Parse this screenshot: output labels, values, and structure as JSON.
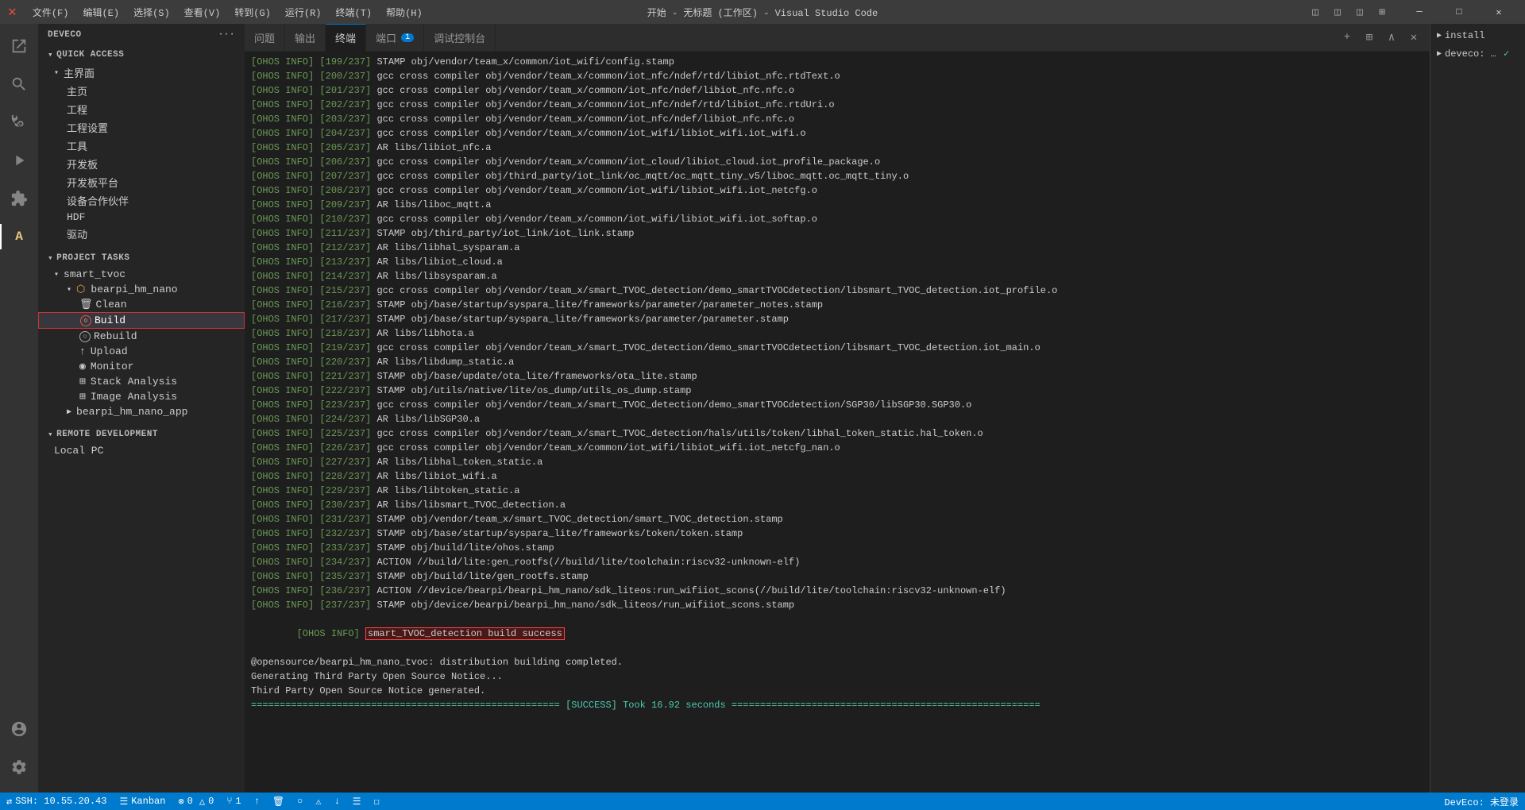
{
  "titleBar": {
    "title": "开始 - 无标题 (工作区) - Visual Studio Code",
    "menu": [
      "文件(F)",
      "编辑(E)",
      "选择(S)",
      "查看(V)",
      "转到(G)",
      "运行(R)",
      "终端(T)",
      "帮助(H)"
    ],
    "controls": [
      "─",
      "□",
      "✕"
    ]
  },
  "sidebar": {
    "header": "DEVECO",
    "quickAccess": "QUICK ACCESS",
    "sections": {
      "mainMenu": "主界面",
      "items": [
        "主页",
        "工程",
        "工程设置",
        "工具",
        "开发板",
        "开发板平台",
        "设备合作伙伴",
        "HDF",
        "驱动"
      ]
    },
    "projectTasks": "PROJECT TASKS",
    "project": {
      "name": "smart_tvoc",
      "device": "bearpi_hm_nano",
      "tasks": [
        "Clean",
        "Build",
        "Rebuild",
        "Upload",
        "Monitor",
        "Stack Analysis",
        "Image Analysis"
      ],
      "subItems": [
        "bearpi_hm_nano_app"
      ]
    },
    "remotedev": "REMOTE DEVELOPMENT",
    "localpc": "Local PC"
  },
  "tabs": [
    {
      "label": "问题",
      "active": false
    },
    {
      "label": "输出",
      "active": false
    },
    {
      "label": "终端",
      "active": true
    },
    {
      "label": "端口",
      "active": false,
      "badge": "1"
    },
    {
      "label": "调试控制台",
      "active": false
    }
  ],
  "terminal": {
    "lines": [
      {
        "num": "199/237",
        "content": "STAMP obj/vendor/team_x/common/iot_wifi/config.stamp"
      },
      {
        "num": "200/237",
        "content": "gcc cross compiler obj/vendor/team_x/common/iot_nfc/ndef/rtd/libiot_nfc.rtdText.o"
      },
      {
        "num": "201/237",
        "content": "gcc cross compiler obj/vendor/team_x/common/iot_nfc/ndef/libiot_nfc.nfc.o"
      },
      {
        "num": "202/237",
        "content": "gcc cross compiler obj/vendor/team_x/common/iot_nfc/ndef/rtd/libiot_nfc.rtdUri.o"
      },
      {
        "num": "203/237",
        "content": "gcc cross compiler obj/vendor/team_x/common/iot_nfc/ndef/libiot_nfc.nfc.o"
      },
      {
        "num": "204/237",
        "content": "gcc cross compiler obj/vendor/team_x/common/iot_wifi/libiot_wifi.iot_wifi.o"
      },
      {
        "num": "205/237",
        "content": "AR libs/libiot_nfc.a"
      },
      {
        "num": "206/237",
        "content": "gcc cross compiler obj/vendor/team_x/common/iot_cloud/libiot_cloud.iot_profile_package.o"
      },
      {
        "num": "207/237",
        "content": "gcc cross compiler obj/third_party/iot_link/oc_mqtt/oc_mqtt_tiny_v5/liboc_mqtt.oc_mqtt_tiny.o"
      },
      {
        "num": "208/237",
        "content": "gcc cross compiler obj/vendor/team_x/common/iot_wifi/libiot_wifi.iot_netcfg.o"
      },
      {
        "num": "209/237",
        "content": "AR libs/liboc_mqtt.a"
      },
      {
        "num": "210/237",
        "content": "gcc cross compiler obj/vendor/team_x/common/iot_wifi/libiot_wifi.iot_softap.o"
      },
      {
        "num": "211/237",
        "content": "STAMP obj/third_party/iot_link/iot_link.stamp"
      },
      {
        "num": "212/237",
        "content": "AR libs/libhal_sysparam.a"
      },
      {
        "num": "213/237",
        "content": "AR libs/libiot_cloud.a"
      },
      {
        "num": "214/237",
        "content": "AR libs/libsysparam.a"
      },
      {
        "num": "215/237",
        "content": "gcc cross compiler obj/vendor/team_x/smart_TVOC_detection/demo_smartTVOCdetection/libsmart_TVOC_detection.iot_profile.o"
      },
      {
        "num": "216/237",
        "content": "STAMP obj/base/startup/syspara_lite/frameworks/parameter/parameter_notes.stamp"
      },
      {
        "num": "217/237",
        "content": "STAMP obj/base/startup/syspara_lite/frameworks/parameter/parameter.stamp"
      },
      {
        "num": "218/237",
        "content": "AR libs/libhota.a"
      },
      {
        "num": "219/237",
        "content": "gcc cross compiler obj/vendor/team_x/smart_TVOC_detection/demo_smartTVOCdetection/libsmart_TVOC_detection.iot_main.o"
      },
      {
        "num": "220/237",
        "content": "AR libs/libdump_static.a"
      },
      {
        "num": "221/237",
        "content": "STAMP obj/base/update/ota_lite/frameworks/ota_lite.stamp"
      },
      {
        "num": "222/237",
        "content": "STAMP obj/utils/native/lite/os_dump/utils_os_dump.stamp"
      },
      {
        "num": "223/237",
        "content": "gcc cross compiler obj/vendor/team_x/smart_TVOC_detection/demo_smartTVOCdetection/SGP30/libSGP30.SGP30.o"
      },
      {
        "num": "224/237",
        "content": "AR libs/libSGP30.a"
      },
      {
        "num": "225/237",
        "content": "gcc cross compiler obj/vendor/team_x/smart_TVOC_detection/hals/utils/token/libhal_token_static.hal_token.o"
      },
      {
        "num": "226/237",
        "content": "gcc cross compiler obj/vendor/team_x/common/iot_wifi/libiot_wifi.iot_netcfg_nan.o"
      },
      {
        "num": "227/237",
        "content": "AR libs/libhal_token_static.a"
      },
      {
        "num": "228/237",
        "content": "AR libs/libiot_wifi.a"
      },
      {
        "num": "229/237",
        "content": "AR libs/libtoken_static.a"
      },
      {
        "num": "230/237",
        "content": "AR libs/libsmart_TVOC_detection.a"
      },
      {
        "num": "231/237",
        "content": "STAMP obj/vendor/team_x/smart_TVOC_detection/smart_TVOC_detection.stamp"
      },
      {
        "num": "232/237",
        "content": "STAMP obj/base/startup/syspara_lite/frameworks/token/token.stamp"
      },
      {
        "num": "233/237",
        "content": "STAMP obj/build/lite/ohos.stamp"
      },
      {
        "num": "234/237",
        "content": "ACTION //build/lite:gen_rootfs(//build/lite/toolchain:riscv32-unknown-elf)"
      },
      {
        "num": "235/237",
        "content": "STAMP obj/build/lite/gen_rootfs.stamp"
      },
      {
        "num": "236/237",
        "content": "ACTION //device/bearpi/bearpi_hm_nano/sdk_liteos:run_wifiiot_scons(//build/lite/toolchain:riscv32-unknown-elf)"
      },
      {
        "num": "237/237",
        "content": "STAMP obj/device/bearpi/bearpi_hm_nano/sdk_liteos/run_wifiiot_scons.stamp"
      }
    ],
    "successLine": "smart_TVOC_detection build success",
    "distLine": "@opensource/bearpi_hm_nano_tvoc: distribution building completed.",
    "noticeLines": [
      "Generating Third Party Open Source Notice...",
      "Third Party Open Source Notice generated."
    ],
    "banner": "====================================================== [SUCCESS] Took 16.92 seconds ======================================================"
  },
  "rightPanel": {
    "items": [
      "install",
      "deveco: ..."
    ]
  },
  "statusBar": {
    "ssh": "SSH: 10.55.20.43",
    "kanban": "Kanban",
    "errors": "⊗ 0",
    "warnings": "△ 0",
    "branch": "⑂1",
    "sync": "↑",
    "trash": "🗑",
    "circle": "○",
    "alert": "⚠",
    "download": "↓",
    "list": "☰",
    "box": "☐",
    "deveco": "DevEco: 未登录"
  }
}
